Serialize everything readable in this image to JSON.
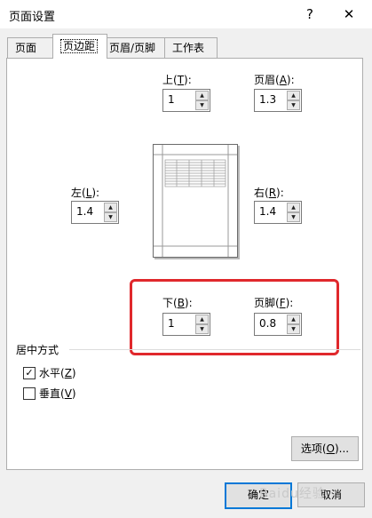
{
  "window": {
    "title": "页面设置",
    "help_glyph": "?",
    "close_glyph": "✕"
  },
  "tabs": [
    {
      "label": "页面",
      "active": false
    },
    {
      "label": "页边距",
      "active": true
    },
    {
      "label": "页眉/页脚",
      "active": false
    },
    {
      "label": "工作表",
      "active": false
    }
  ],
  "margins": {
    "top": {
      "label_pre": "上(",
      "key": "T",
      "label_post": "):",
      "value": "1"
    },
    "header": {
      "label_pre": "页眉(",
      "key": "A",
      "label_post": "):",
      "value": "1.3"
    },
    "left": {
      "label_pre": "左(",
      "key": "L",
      "label_post": "):",
      "value": "1.4"
    },
    "right": {
      "label_pre": "右(",
      "key": "R",
      "label_post": "):",
      "value": "1.4"
    },
    "bottom": {
      "label_pre": "下(",
      "key": "B",
      "label_post": "):",
      "value": "1"
    },
    "footer": {
      "label_pre": "页脚(",
      "key": "F",
      "label_post": "):",
      "value": "0.8"
    }
  },
  "center_on_page": {
    "label": "居中方式",
    "horizontal": {
      "label_pre": "水平(",
      "key": "Z",
      "label_post": ")",
      "checked": true
    },
    "vertical": {
      "label_pre": "垂直(",
      "key": "V",
      "label_post": ")",
      "checked": false
    }
  },
  "buttons": {
    "options": {
      "label_pre": "选项(",
      "key": "O",
      "label_post": ")..."
    },
    "ok": "确定",
    "cancel": "取消"
  },
  "watermark": "Baidu经验",
  "colors": {
    "highlight_box": "#e0282c",
    "default_button_border": "#0078d7"
  }
}
